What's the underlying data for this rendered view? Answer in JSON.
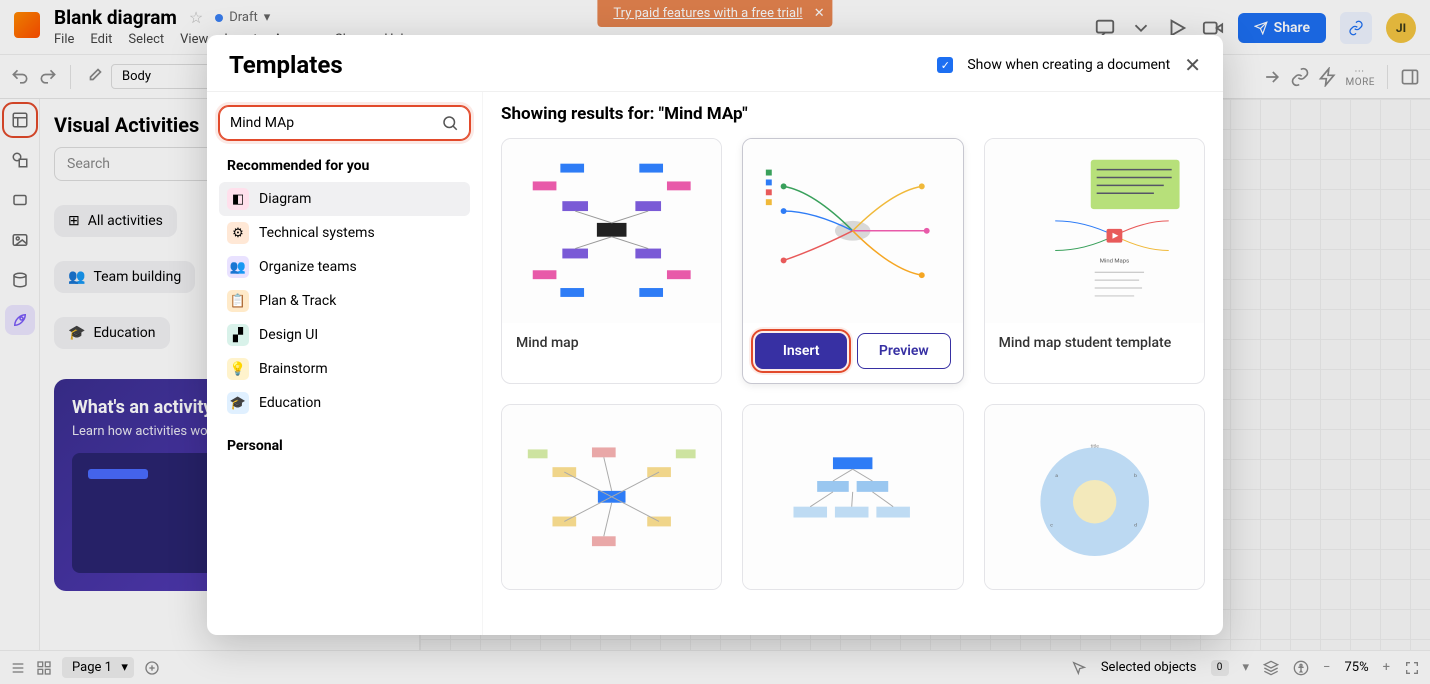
{
  "banner": {
    "text": "Try paid features with a free trial!"
  },
  "header": {
    "doc_title": "Blank diagram",
    "status": "Draft",
    "avatar": "JI",
    "share": "Share",
    "menu": [
      "File",
      "Edit",
      "Select",
      "View",
      "Insert",
      "Arrange",
      "Share",
      "Help"
    ]
  },
  "toolbar": {
    "style_select": "Body",
    "more": "MORE"
  },
  "left_panel": {
    "title": "Visual Activities",
    "search_placeholder": "Search",
    "chips": [
      "All activities",
      "Team building",
      "Education"
    ],
    "learn_title": "What's an activity?",
    "learn_body": "Learn how activities work"
  },
  "modal": {
    "title": "Templates",
    "show_label": "Show when creating a document",
    "search_value": "Mind MAp",
    "recommended": "Recommended for you",
    "categories": [
      "Diagram",
      "Technical systems",
      "Organize teams",
      "Plan & Track",
      "Design UI",
      "Brainstorm",
      "Education"
    ],
    "personal": "Personal",
    "results_prefix": "Showing results for: ",
    "results_query": "\"Mind MAp\"",
    "templates": [
      {
        "name": "Mind map"
      },
      {
        "name": "",
        "insert": "Insert",
        "preview": "Preview"
      },
      {
        "name": "Mind map student template"
      }
    ]
  },
  "footer": {
    "page": "Page 1",
    "selected": "Selected objects",
    "selected_count": "0",
    "zoom": "75%"
  }
}
